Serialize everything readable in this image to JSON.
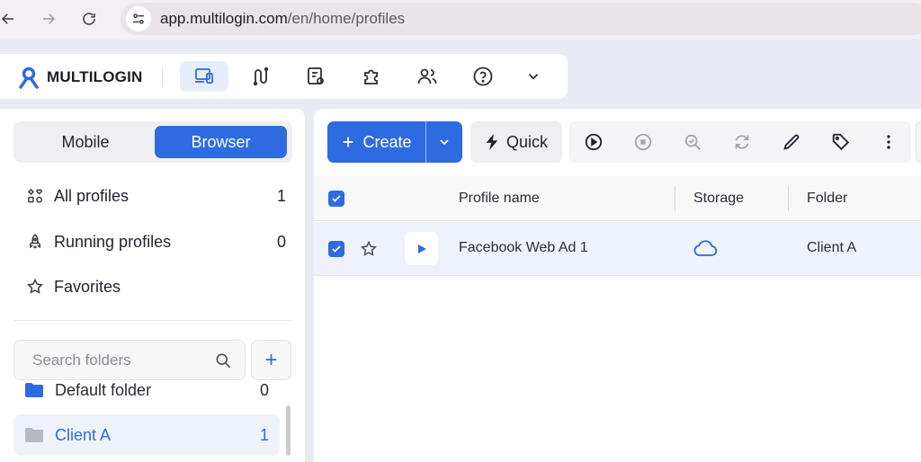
{
  "browser": {
    "url_host": "app.multilogin.com",
    "url_path": "/en/home/profiles"
  },
  "topnav": {
    "logo_text": "MULTILOGIN",
    "icons": [
      "profiles-icon",
      "automation-icon",
      "proxy-icon",
      "extensions-icon",
      "team-icon",
      "help-icon",
      "chevron-down-icon"
    ]
  },
  "sidebar": {
    "segment": {
      "mobile": "Mobile",
      "browser": "Browser",
      "selected": "Browser"
    },
    "items": [
      {
        "label": "All profiles",
        "count": "1",
        "icon": "all-profiles-icon"
      },
      {
        "label": "Running profiles",
        "count": "0",
        "icon": "rocket-icon"
      },
      {
        "label": "Favorites",
        "count": "",
        "icon": "star-icon"
      }
    ],
    "search_placeholder": "Search folders",
    "add_folder_label": "+",
    "folders": [
      {
        "name": "Default folder",
        "count": "0"
      },
      {
        "name": "Client A",
        "count": "1",
        "selected": true
      }
    ]
  },
  "main": {
    "create_label": "Create",
    "quick_label": "Quick",
    "toolbar_icons": [
      "play-icon",
      "stop-icon",
      "search-check-icon",
      "sync-icon",
      "pencil-icon",
      "tag-icon",
      "more-vertical-icon"
    ],
    "table": {
      "columns": [
        "Profile name",
        "Storage",
        "Folder"
      ],
      "rows": [
        {
          "profile_name": "Facebook Web Ad 1",
          "storage": "cloud-icon",
          "folder": "Client A",
          "checked": true,
          "favorite": false
        }
      ]
    }
  },
  "colors": {
    "accent": "#2f6be0",
    "selected_row": "#eef2fb"
  }
}
